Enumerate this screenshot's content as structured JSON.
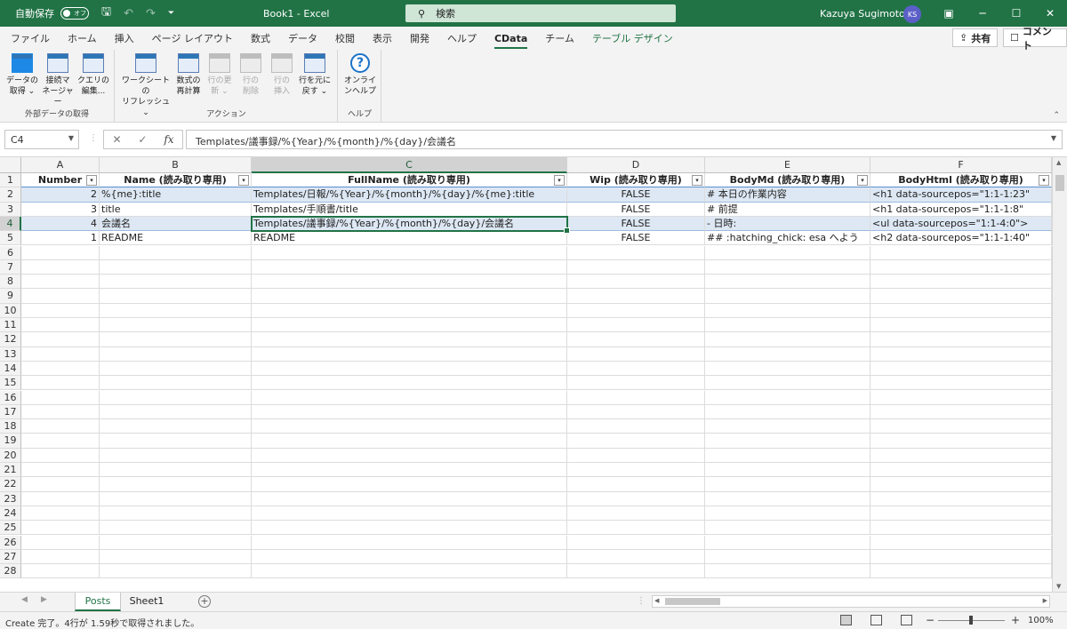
{
  "titlebar": {
    "autosave_label": "自動保存",
    "toggle_label": "オフ",
    "doc_title": "Book1  -  Excel",
    "search_placeholder": "検索",
    "user_name": "Kazuya Sugimoto",
    "avatar_initials": "KS"
  },
  "tabs": [
    "ファイル",
    "ホーム",
    "挿入",
    "ページ レイアウト",
    "数式",
    "データ",
    "校閲",
    "表示",
    "開発",
    "ヘルプ",
    "CData",
    "チーム",
    "テーブル デザイン"
  ],
  "active_tab": "CData",
  "share_label": "共有",
  "comment_label": "コメント",
  "ribbon": {
    "groups": [
      {
        "label": "外部データの取得",
        "buttons": [
          {
            "line1": "データの",
            "line2": "取得 ⌄",
            "disabled": false
          },
          {
            "line1": "接続マ",
            "line2": "ネージャー",
            "disabled": false
          },
          {
            "line1": "クエリの",
            "line2": "編集...",
            "disabled": false
          }
        ]
      },
      {
        "label": "アクション",
        "buttons": [
          {
            "line1": "ワークシートの",
            "line2": "リフレッシュ ⌄",
            "disabled": false
          },
          {
            "line1": "数式の",
            "line2": "再計算",
            "disabled": false
          },
          {
            "line1": "行の更",
            "line2": "新 ⌄",
            "disabled": true
          },
          {
            "line1": "行の",
            "line2": "削除",
            "disabled": true
          },
          {
            "line1": "行の",
            "line2": "挿入",
            "disabled": true
          },
          {
            "line1": "行を元に",
            "line2": "戻す ⌄",
            "disabled": false
          }
        ]
      },
      {
        "label": "ヘルプ",
        "buttons": [
          {
            "line1": "オンライ",
            "line2": "ンヘルプ",
            "disabled": false
          }
        ]
      }
    ]
  },
  "formula_bar": {
    "name_box": "C4",
    "fx_label": "fx",
    "formula": "Templates/議事録/%{Year}/%{month}/%{day}/会議名"
  },
  "columns": [
    "A",
    "B",
    "C",
    "D",
    "E",
    "F"
  ],
  "selected_column": "C",
  "headers": [
    "Number",
    "Name (読み取り専用)",
    "FullName (読み取り専用)",
    "Wip (読み取り専用)",
    "BodyMd (読み取り専用)",
    "BodyHtml (読み取り専用)"
  ],
  "rows": [
    [
      "2",
      "%{me}:title",
      "Templates/日報/%{Year}/%{month}/%{day}/%{me}:title",
      "FALSE",
      "# 本日の作業内容",
      "<h1 data-sourcepos=\"1:1-1:23\""
    ],
    [
      "3",
      "title",
      "Templates/手順書/title",
      "FALSE",
      "# 前提",
      "<h1 data-sourcepos=\"1:1-1:8\""
    ],
    [
      "4",
      "会議名",
      "Templates/議事録/%{Year}/%{month}/%{day}/会議名",
      "FALSE",
      "- 日時:",
      "<ul data-sourcepos=\"1:1-4:0\">"
    ],
    [
      "1",
      "README",
      "README",
      "FALSE",
      "##  :hatching_chick: esa へよう",
      "<h2 data-sourcepos=\"1:1-1:40\""
    ]
  ],
  "row_numbers": [
    "1",
    "2",
    "3",
    "4",
    "5",
    "6",
    "7",
    "8",
    "9",
    "10",
    "11",
    "12",
    "13",
    "14",
    "15",
    "16",
    "17",
    "18",
    "19",
    "20",
    "21",
    "22",
    "23",
    "24",
    "25",
    "26",
    "27",
    "28"
  ],
  "selected_row": "4",
  "sheets": [
    "Posts",
    "Sheet1"
  ],
  "active_sheet": "Posts",
  "status": {
    "message": "Create 完了。4行が 1.59秒で取得されました。",
    "zoom": "100%",
    "zoom_minus": "−",
    "zoom_plus": "+"
  }
}
